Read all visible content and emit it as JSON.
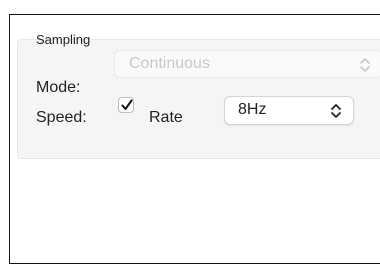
{
  "panel": {
    "title": "Sampling",
    "mode_label": "Mode:",
    "mode_value": "Continuous",
    "mode_enabled": false,
    "speed_label": "Speed:",
    "rate_checkbox_checked": true,
    "rate_label": "Rate",
    "rate_value": "8Hz"
  },
  "icons": {
    "mode_stepper": "chevron-up-down-icon",
    "rate_stepper": "chevron-up-down-icon",
    "checkmark": "checkmark-icon"
  },
  "colors": {
    "panel_background": "#f5f5f5",
    "disabled_text": "#c8c8c8",
    "text": "#222222"
  }
}
